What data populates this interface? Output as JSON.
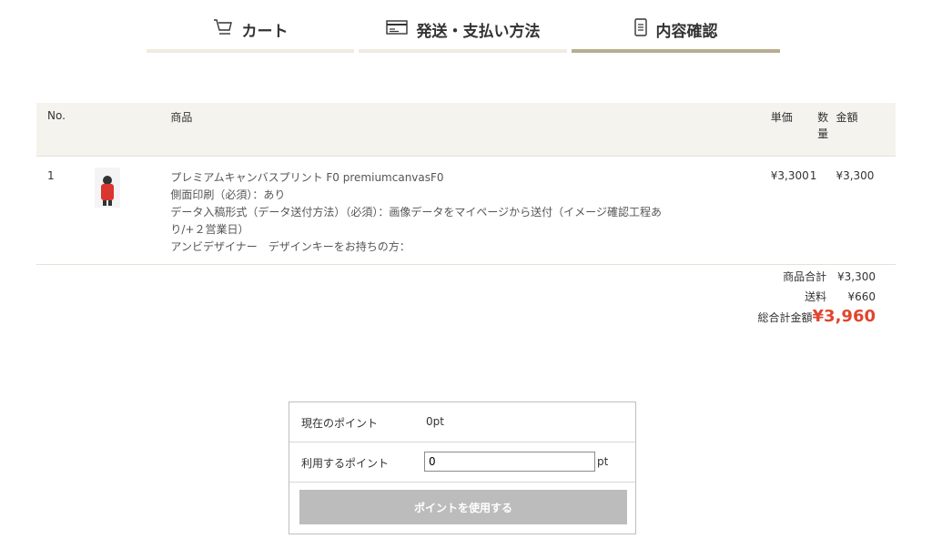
{
  "steps": [
    {
      "label": "カート",
      "icon": "cart-icon"
    },
    {
      "label": "発送・支払い方法",
      "icon": "card-icon"
    },
    {
      "label": "内容確認",
      "icon": "document-icon",
      "active": true
    }
  ],
  "table": {
    "headers": {
      "no": "No.",
      "product": "商品",
      "unit_price": "単価",
      "qty": "数量",
      "amount": "金額"
    },
    "rows": [
      {
        "no": "1",
        "product_lines": [
          "プレミアムキャンバスプリント F0 premiumcanvasF0",
          "側面印刷（必須）：あり",
          "データ入稿形式（データ送付方法）（必須）：画像データをマイページから送付（イメージ確認工程あ",
          "り/+２営業日）",
          "アンビデザイナー　デザインキーをお持ちの方："
        ],
        "unit_price": "¥3,300",
        "qty": "1",
        "amount": "¥3,300"
      }
    ]
  },
  "totals": {
    "subtotal_label": "商品合計",
    "subtotal": "¥3,300",
    "shipping_label": "送料",
    "shipping": "¥660",
    "grand_label": "総合計金額",
    "grand": "¥3,960"
  },
  "points": {
    "current_label": "現在のポイント",
    "current_value": "0pt",
    "use_label": "利用するポイント",
    "use_value": "0",
    "unit": "pt",
    "button_label": "ポイントを使用する"
  },
  "colors": {
    "accent_bar": "#b8ad91",
    "grand_total": "#e0452f",
    "button_disabled": "#bcbcbc"
  }
}
